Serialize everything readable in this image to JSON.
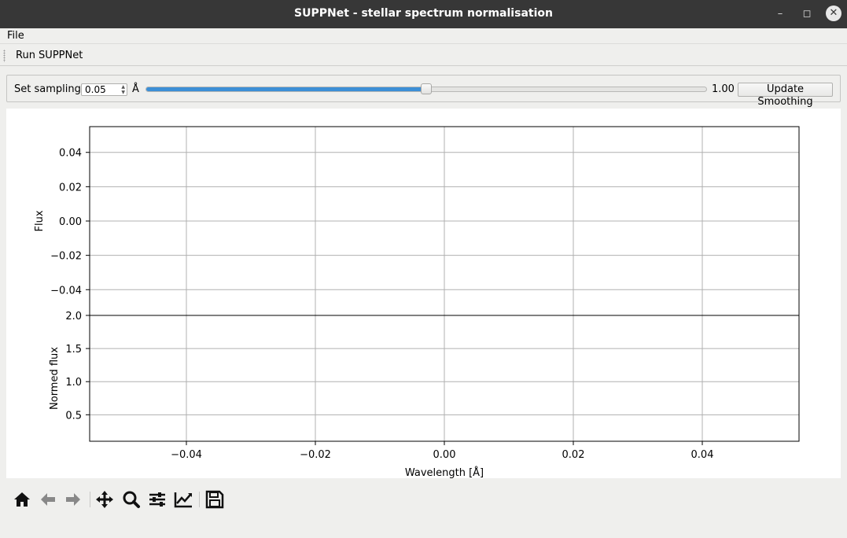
{
  "window": {
    "title": "SUPPNet - stellar spectrum normalisation",
    "controls": {
      "minimize": "–",
      "maximize": "◻",
      "close": "✕"
    }
  },
  "menubar": {
    "file_label": "File"
  },
  "toolbar": {
    "run_label": "Run SUPPNet"
  },
  "controls": {
    "sampling_label": "Set sampling",
    "sampling_value": "0.05",
    "sampling_unit": "Å",
    "slider_max_label": "1.00",
    "slider_fraction": 0.5,
    "update_label": "Update Smoothing",
    "accent_color": "#3c8fd6"
  },
  "chart_data": [
    {
      "type": "line",
      "series": [],
      "ylabel": "Flux",
      "xlim": [
        -0.055,
        0.055
      ],
      "ylim": [
        -0.055,
        0.055
      ],
      "yticks": [
        0.04,
        0.02,
        0.0,
        -0.02,
        -0.04
      ],
      "ytick_labels": [
        "0.04",
        "0.02",
        "0.00",
        "−0.02",
        "−0.04"
      ],
      "grid": true
    },
    {
      "type": "line",
      "series": [],
      "xlabel": "Wavelength [Å]",
      "ylabel": "Normed flux",
      "xlim": [
        -0.055,
        0.055
      ],
      "ylim": [
        0.1,
        2.0
      ],
      "xticks": [
        -0.04,
        -0.02,
        0.0,
        0.02,
        0.04
      ],
      "xtick_labels": [
        "−0.04",
        "−0.02",
        "0.00",
        "0.02",
        "0.04"
      ],
      "yticks": [
        2.0,
        1.5,
        1.0,
        0.5
      ],
      "ytick_labels": [
        "2.0",
        "1.5",
        "1.0",
        "0.5"
      ],
      "grid": true
    }
  ],
  "navigation_toolbar": {
    "icons": [
      "home-icon",
      "back-arrow-icon",
      "forward-arrow-icon",
      "pan-icon",
      "zoom-icon",
      "configure-subplots-icon",
      "edit-axes-icon",
      "save-icon"
    ]
  }
}
